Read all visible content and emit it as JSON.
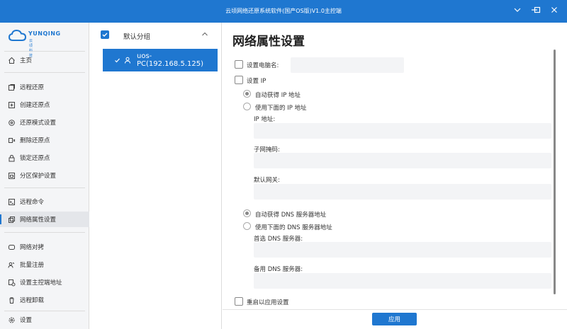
{
  "window": {
    "title": "云顷网络还原系统软件(国产OS版)V1.0主控端"
  },
  "logo": {
    "name": "YUNQING",
    "sub": "云 顷 科 技"
  },
  "sidebar": {
    "items": [
      {
        "label": "主页",
        "icon": "home-icon"
      },
      {
        "label": "远程还原",
        "icon": "restore-icon"
      },
      {
        "label": "创建还原点",
        "icon": "create-point-icon"
      },
      {
        "label": "还原模式设置",
        "icon": "mode-settings-icon"
      },
      {
        "label": "删除还原点",
        "icon": "delete-point-icon"
      },
      {
        "label": "锁定还原点",
        "icon": "lock-icon"
      },
      {
        "label": "分区保护设置",
        "icon": "partition-icon"
      },
      {
        "label": "远程命令",
        "icon": "terminal-icon"
      },
      {
        "label": "网络属性设置",
        "icon": "network-settings-icon"
      },
      {
        "label": "网络对拷",
        "icon": "network-copy-icon"
      },
      {
        "label": "批量注册",
        "icon": "batch-register-icon"
      },
      {
        "label": "设置主控端地址",
        "icon": "server-address-icon"
      },
      {
        "label": "远程卸载",
        "icon": "uninstall-icon"
      },
      {
        "label": "设置",
        "icon": "settings-icon"
      }
    ],
    "active_index": 8
  },
  "groups": {
    "group_name": "默认分组",
    "group_checked": true,
    "devices": [
      {
        "name": "uos-PC(192.168.5.125)",
        "selected": true
      }
    ]
  },
  "main": {
    "title": "网络属性设置",
    "set_name_label": "设置电脑名:",
    "set_ip_label": "设置 IP",
    "ip_auto_label": "自动获得 IP 地址",
    "ip_manual_label": "使用下面的 IP 地址",
    "ip_address_label": "IP 地址:",
    "subnet_label": "子网掩码:",
    "gateway_label": "默认网关:",
    "dns_auto_label": "自动获得 DNS 服务器地址",
    "dns_manual_label": "使用下面的 DNS 服务器地址",
    "dns_primary_label": "首选 DNS 服务器:",
    "dns_secondary_label": "备用 DNS 服务器:",
    "restart_label": "重启以应用设置",
    "apply_button": "应用"
  }
}
